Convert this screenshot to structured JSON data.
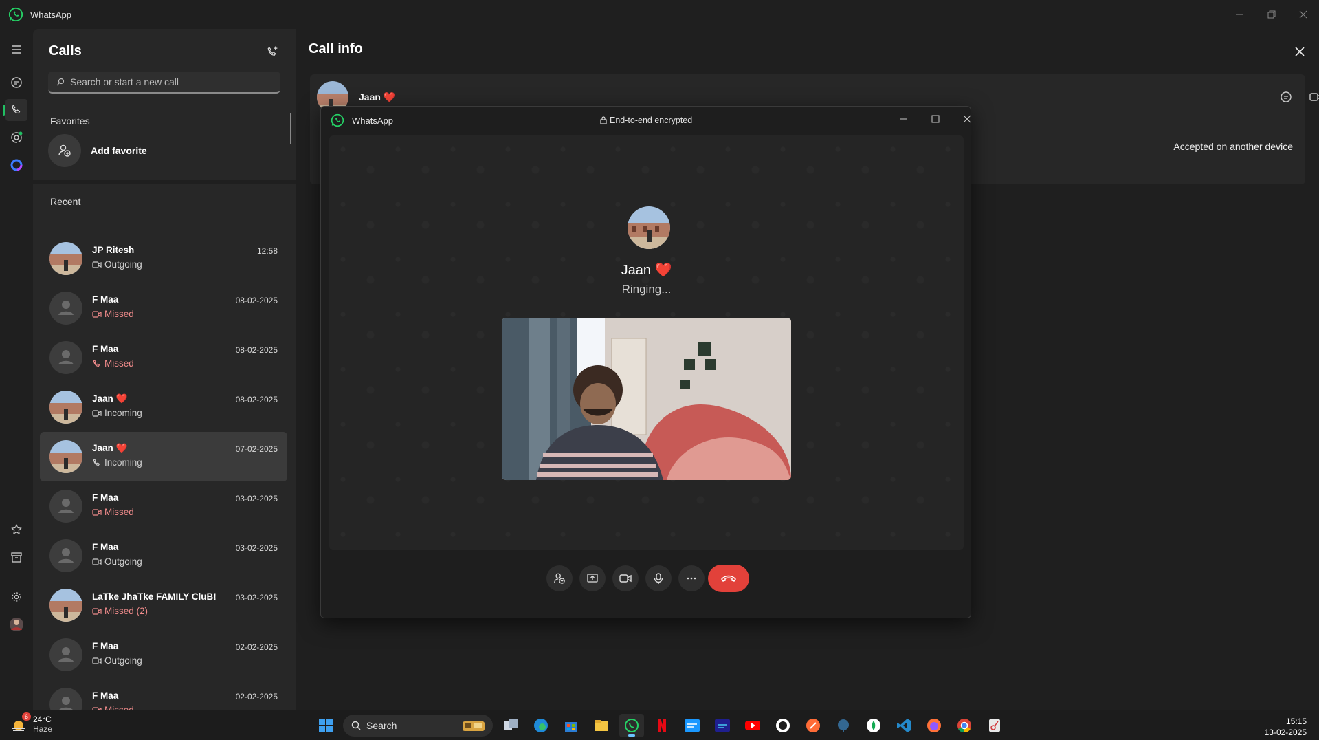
{
  "app": {
    "title": "WhatsApp"
  },
  "calls": {
    "header": "Calls",
    "search_placeholder": "Search or start a new call",
    "favorites_label": "Favorites",
    "add_favorite": "Add favorite",
    "recent_label": "Recent",
    "items": [
      {
        "name": "JP Ritesh",
        "date": "12:58",
        "status": "Outgoing",
        "type": "video",
        "missed": false,
        "photo": true
      },
      {
        "name": "F Maa",
        "date": "08-02-2025",
        "status": "Missed",
        "type": "video",
        "missed": true,
        "photo": false
      },
      {
        "name": "F Maa",
        "date": "08-02-2025",
        "status": "Missed",
        "type": "voice",
        "missed": true,
        "photo": false
      },
      {
        "name": "Jaan ❤️",
        "date": "08-02-2025",
        "status": "Incoming",
        "type": "video",
        "missed": false,
        "photo": true
      },
      {
        "name": "Jaan ❤️",
        "date": "07-02-2025",
        "status": "Incoming",
        "type": "voice",
        "missed": false,
        "photo": true,
        "selected": true
      },
      {
        "name": "F Maa",
        "date": "03-02-2025",
        "status": "Missed",
        "type": "video",
        "missed": true,
        "photo": false
      },
      {
        "name": "F Maa",
        "date": "03-02-2025",
        "status": "Outgoing",
        "type": "video",
        "missed": false,
        "photo": false
      },
      {
        "name": "LaTke JhaTke FAMILY CluB!",
        "date": "03-02-2025",
        "status": "Missed (2)",
        "type": "video",
        "missed": true,
        "photo": true
      },
      {
        "name": "F Maa",
        "date": "02-02-2025",
        "status": "Outgoing",
        "type": "video",
        "missed": false,
        "photo": false
      },
      {
        "name": "F Maa",
        "date": "02-02-2025",
        "status": "Missed",
        "type": "video",
        "missed": true,
        "photo": false
      }
    ]
  },
  "call_info": {
    "title": "Call info",
    "contact_name": "Jaan ❤️",
    "accepted_text": "Accepted on another device"
  },
  "call_window": {
    "title": "WhatsApp",
    "encryption": "End-to-end encrypted",
    "callee_name": "Jaan ❤️",
    "status": "Ringing..."
  },
  "taskbar": {
    "badge": "6",
    "temperature": "24°C",
    "condition": "Haze",
    "search_label": "Search",
    "time": "15:15",
    "date": "13-02-2025"
  },
  "colors": {
    "accent": "#21c063",
    "missed": "#f08b8b",
    "end_call": "#e2413a"
  }
}
